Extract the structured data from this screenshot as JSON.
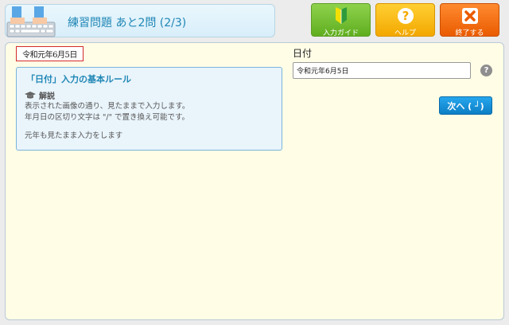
{
  "header": {
    "title": "練習問題 あと2問 (2/3)"
  },
  "toolbar": {
    "guide_label": "入力ガイド",
    "help_label": "ヘルプ",
    "exit_label": "終了する"
  },
  "question": {
    "handwritten_text": "令和元年6月5日"
  },
  "rules": {
    "title": "「日付」入力の基本ルール",
    "section": "解説",
    "lines": [
      "表示された画像の通り、見たままで入力します。",
      "年月日の区切り文字は \"/\" で置き換え可能です。",
      "元年も見たまま入力をします"
    ]
  },
  "form": {
    "field_label": "日付",
    "date_value": "令和元年6月5日",
    "next_label": "次へ ( ┘)"
  },
  "colors": {
    "accent": "#1f86b5",
    "guide": "#6cbb2a",
    "help": "#f6b60a",
    "exit": "#f06a12",
    "next": "#1592dc"
  }
}
